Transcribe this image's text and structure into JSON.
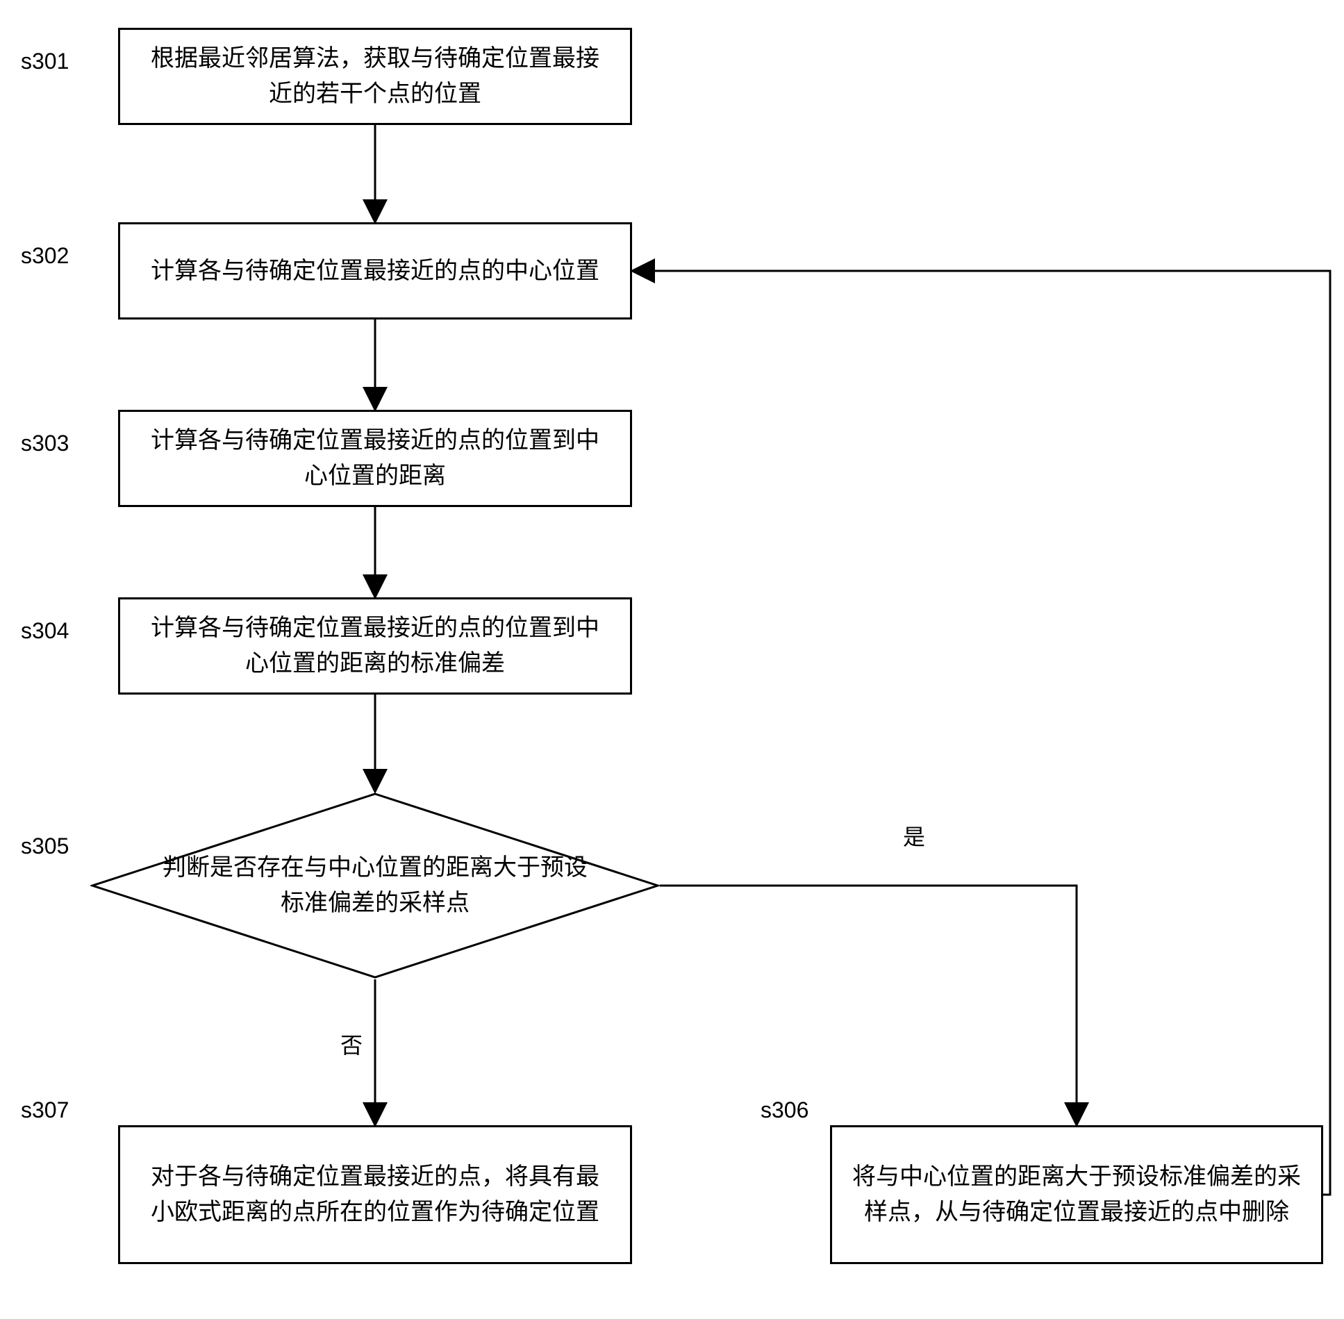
{
  "chart_data": {
    "type": "flowchart",
    "nodes": [
      {
        "id": "s301",
        "kind": "process",
        "text": "根据最近邻居算法，获取与待确定位置最接近的若干个点的位置"
      },
      {
        "id": "s302",
        "kind": "process",
        "text": "计算各与待确定位置最接近的点的中心位置"
      },
      {
        "id": "s303",
        "kind": "process",
        "text": "计算各与待确定位置最接近的点的位置到中心位置的距离"
      },
      {
        "id": "s304",
        "kind": "process",
        "text": "计算各与待确定位置最接近的点的位置到中心位置的距离的标准偏差"
      },
      {
        "id": "s305",
        "kind": "decision",
        "text": "判断是否存在与中心位置的距离大于预设标准偏差的采样点"
      },
      {
        "id": "s306",
        "kind": "process",
        "text": "将与中心位置的距离大于预设标准偏差的采样点，从与待确定位置最接近的点中删除"
      },
      {
        "id": "s307",
        "kind": "process",
        "text": "对于各与待确定位置最接近的点，将具有最小欧式距离的点所在的位置作为待确定位置"
      }
    ],
    "edges": [
      {
        "from": "s301",
        "to": "s302"
      },
      {
        "from": "s302",
        "to": "s303"
      },
      {
        "from": "s303",
        "to": "s304"
      },
      {
        "from": "s304",
        "to": "s305"
      },
      {
        "from": "s305",
        "to": "s306",
        "label": "是"
      },
      {
        "from": "s305",
        "to": "s307",
        "label": "否"
      },
      {
        "from": "s306",
        "to": "s302"
      }
    ]
  },
  "labels": {
    "s301": "s301",
    "s302": "s302",
    "s303": "s303",
    "s304": "s304",
    "s305": "s305",
    "s306": "s306",
    "s307": "s307"
  },
  "branches": {
    "yes": "是",
    "no": "否"
  }
}
